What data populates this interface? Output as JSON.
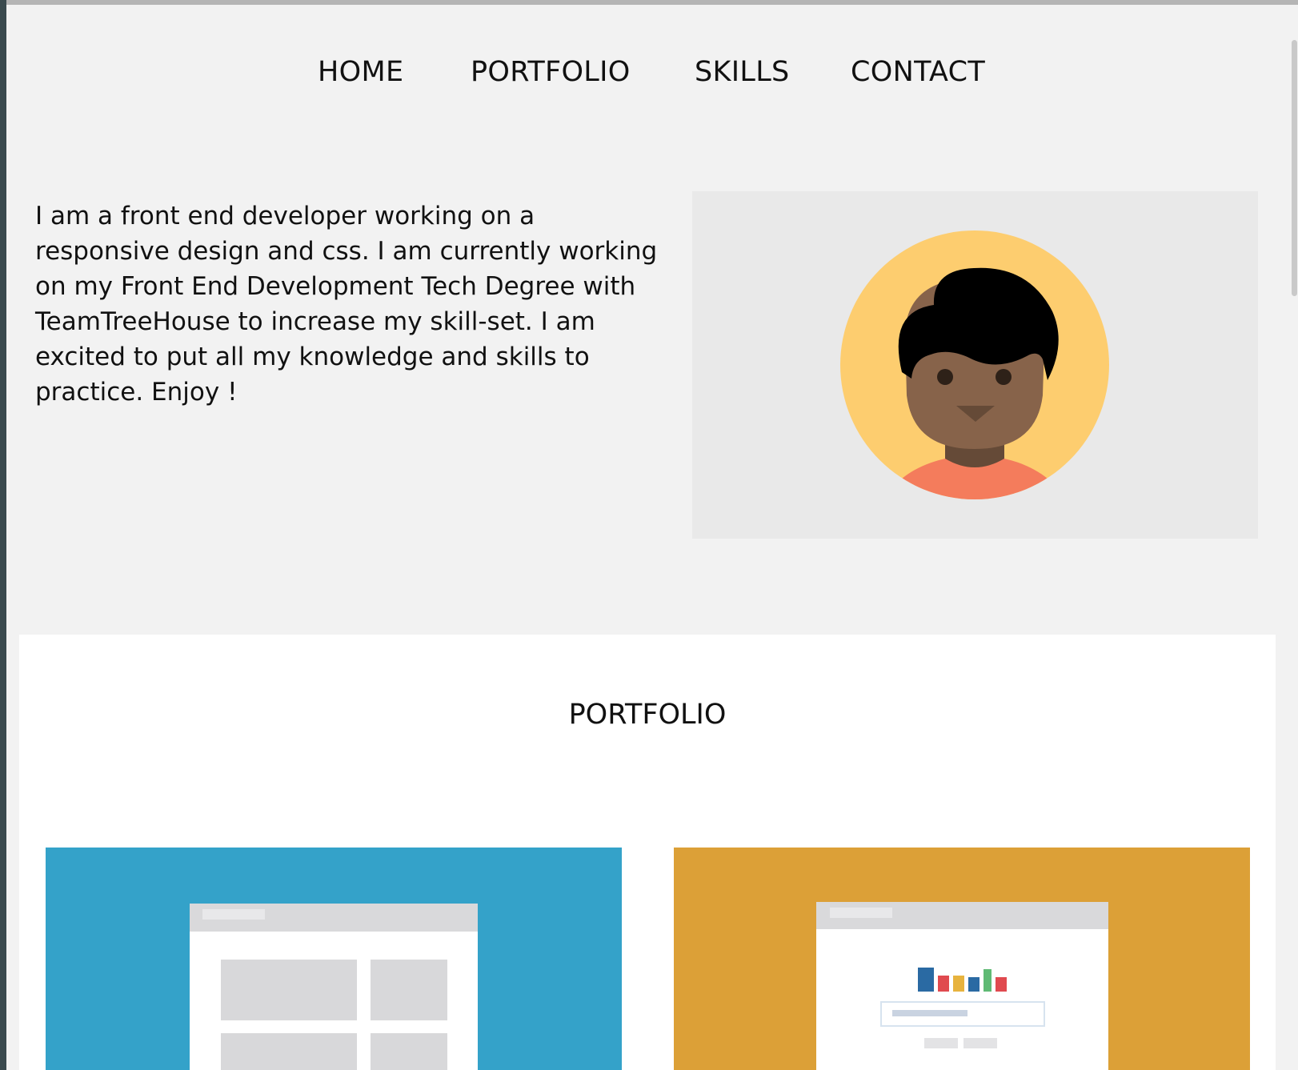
{
  "nav": {
    "items": [
      {
        "label": "HOME"
      },
      {
        "label": "PORTFOLIO"
      },
      {
        "label": "SKILLS"
      },
      {
        "label": "CONTACT"
      }
    ]
  },
  "intro": {
    "text": "I am a front end developer working on a responsive design and css. I am currently working on my Front End Development Tech Degree with TeamTreeHouse to increase my skill-set. I am excited to put all my knowledge and skills to practice. Enjoy !"
  },
  "hero": {
    "icon": "avatar-illustration",
    "colors": {
      "background": "#e9e9e9",
      "circle": "#fdcd6f",
      "skin": "#87634a",
      "hair": "#000000",
      "shirt": "#f47c5c"
    }
  },
  "portfolio": {
    "title": "PORTFOLIO",
    "cards": [
      {
        "icon": "layout-mockup-illustration",
        "color": "#34a2c9"
      },
      {
        "icon": "chart-mockup-illustration",
        "color": "#dca037"
      }
    ]
  }
}
